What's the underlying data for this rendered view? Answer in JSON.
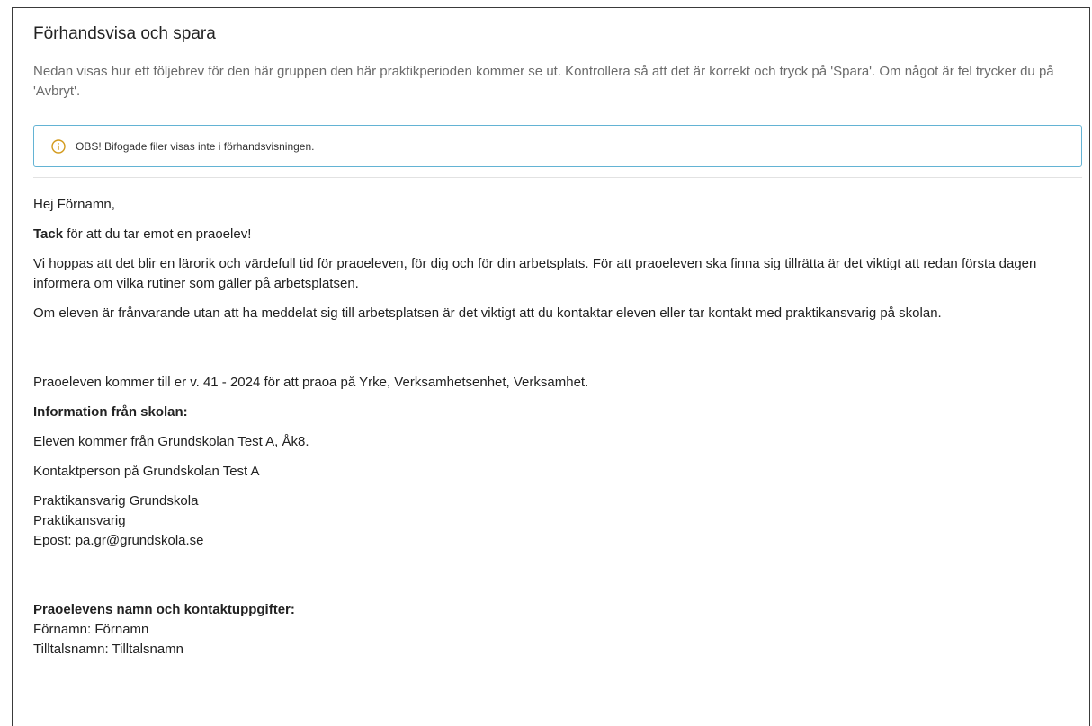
{
  "dialog": {
    "title": "Förhandsvisa och spara",
    "intro": "Nedan visas hur ett följebrev för den här gruppen den här praktikperioden kommer se ut. Kontrollera så att det är korrekt och tryck på 'Spara'. Om något är fel trycker du på 'Avbryt'.",
    "notice": {
      "icon": "info-circle-icon",
      "text": "OBS! Bifogade filer visas inte i förhandsvisningen.",
      "border_color": "#63b3d4"
    }
  },
  "letter": {
    "greeting": "Hej Förnamn,",
    "thanks_bold": "Tack",
    "thanks_rest": " för att du tar emot en praoelev!",
    "paragraph_1": "Vi hoppas att det blir en lärorik och värdefull tid för praoeleven, för dig och för din arbetsplats. För att praoeleven ska finna sig tillrätta är det viktigt att redan första dagen informera om vilka rutiner som gäller på arbetsplatsen.",
    "paragraph_2": "Om eleven är frånvarande utan att ha meddelat sig till arbetsplatsen är det viktigt att du kontaktar eleven eller tar kontakt med praktikansvarig på skolan.",
    "arrival": "Praoeleven kommer till er v. 41 - 2024 för att praoa på Yrke, Verksamhetsenhet, Verksamhet.",
    "school_info_heading": "Information från skolan:",
    "school_line": "Eleven kommer från Grundskolan Test A, Åk8.",
    "contact_heading": "Kontaktperson på Grundskolan Test A",
    "contact_name": "Praktikansvarig Grundskola",
    "contact_role": "Praktikansvarig",
    "contact_email": "Epost: pa.gr@grundskola.se",
    "student_heading": "Praoelevens namn och kontaktuppgifter:",
    "student_firstname": "Förnamn: Förnamn",
    "student_nickname": "Tilltalsnamn: Tilltalsnamn"
  }
}
